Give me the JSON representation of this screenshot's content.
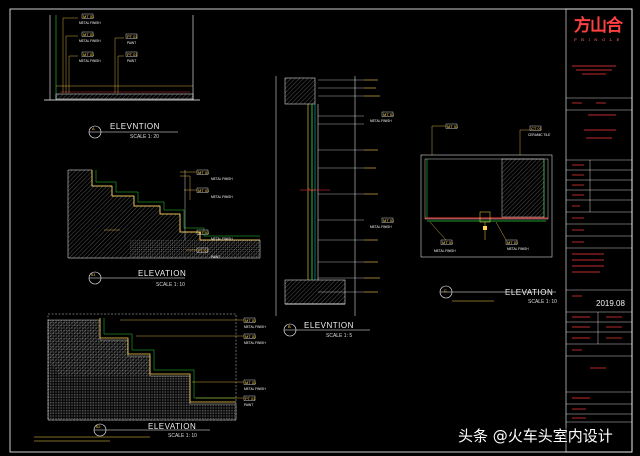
{
  "sheet": {
    "view_a_title": "ELEVNTION",
    "view_a_label": "A",
    "view_a_scale": "SCALE  1: 20",
    "view_d1_title": "ELEVATION",
    "view_d1_label": "01",
    "view_d1_scale": "SCALE  1: 10",
    "view_d2_title": "ELEVATION",
    "view_d2_label": "02",
    "view_d2_scale": "SCALE  1: 10",
    "view_b_title": "ELEVNTION",
    "view_b_label": "B",
    "view_b_scale": "SCALE  1: 5",
    "view_c_title": "ELEVATION",
    "view_c_label": "C",
    "view_c_scale": "SCALE  1: 10"
  },
  "tags": {
    "mt01": "MT 01",
    "pt01": "PT 01",
    "ct01": "CT 01",
    "metal_finish": "METAL FINISH",
    "paint": "PAINT",
    "ceramic_tile": "CERAMIC TILE"
  },
  "title_block": {
    "brand": "方山合",
    "brand_sub": "F R I N G L E",
    "date": "2019.08"
  },
  "watermark": "头条 @火车头室内设计",
  "colors": {
    "background": "#000000",
    "frame": "#ffffff",
    "title_block_red": "#ff3b3b",
    "annotation_yellow": "#ffd34d",
    "leader_green": "#2bd13b",
    "hatch_gray": "#8a8a8a",
    "cyan": "#27d9e8"
  }
}
